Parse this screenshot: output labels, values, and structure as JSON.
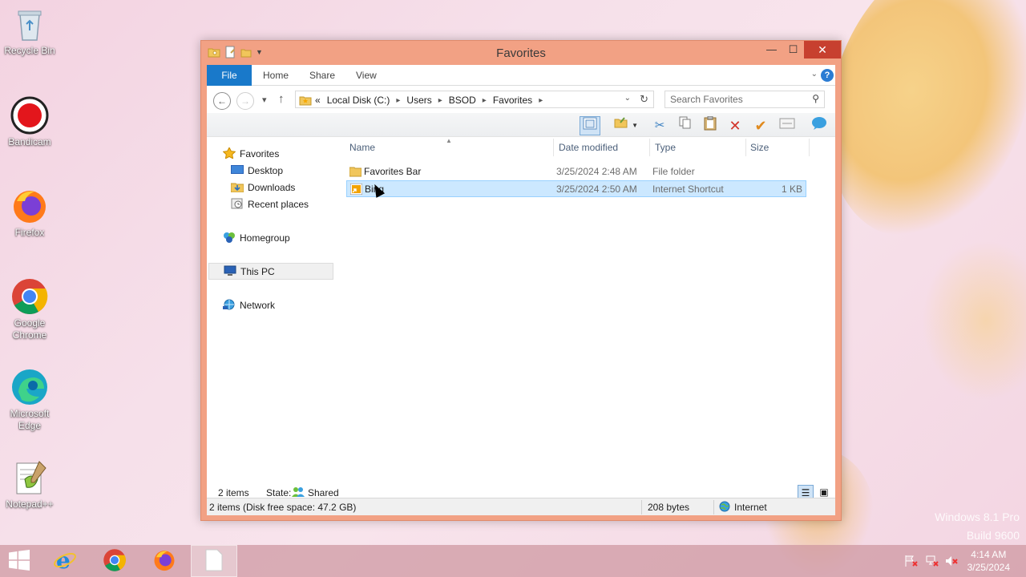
{
  "desktop": {
    "icons": [
      {
        "label": "Recycle Bin"
      },
      {
        "label": "Bandicam"
      },
      {
        "label": "Firefox"
      },
      {
        "label": "Google Chrome"
      },
      {
        "label": "Microsoft Edge"
      },
      {
        "label": "Notepad++"
      }
    ],
    "watermark_line1": "Windows 8.1 Pro",
    "watermark_line2": "Build 9600"
  },
  "window": {
    "title": "Favorites",
    "ribbon_tabs": {
      "file": "File",
      "home": "Home",
      "share": "Share",
      "view": "View"
    },
    "help_glyph": "?",
    "address": {
      "overflow": "«",
      "crumbs": [
        "Local Disk (C:)",
        "Users",
        "BSOD",
        "Favorites"
      ]
    },
    "search_placeholder": "Search Favorites",
    "nav": {
      "favorites": "Favorites",
      "desktop": "Desktop",
      "downloads": "Downloads",
      "recent": "Recent places",
      "homegroup": "Homegroup",
      "thispc": "This PC",
      "network": "Network"
    },
    "columns": {
      "name": "Name",
      "date": "Date modified",
      "type": "Type",
      "size": "Size"
    },
    "files": [
      {
        "name": "Favorites Bar",
        "date": "3/25/2024 2:48 AM",
        "type": "File folder",
        "size": ""
      },
      {
        "name": "Bing",
        "date": "3/25/2024 2:50 AM",
        "type": "Internet Shortcut",
        "size": "1 KB"
      }
    ],
    "status": {
      "items": "2 items",
      "state_label": "State:",
      "state_value": "Shared"
    },
    "statusbar": {
      "summary": "2 items (Disk free space: 47.2 GB)",
      "bytes": "208 bytes",
      "zone": "Internet"
    }
  },
  "taskbar": {
    "time": "4:14 AM",
    "date": "3/25/2024"
  },
  "colors": {
    "accent": "#1979ca",
    "window_frame": "#f2a184",
    "close": "#c7402f",
    "selection": "#cce8ff"
  }
}
